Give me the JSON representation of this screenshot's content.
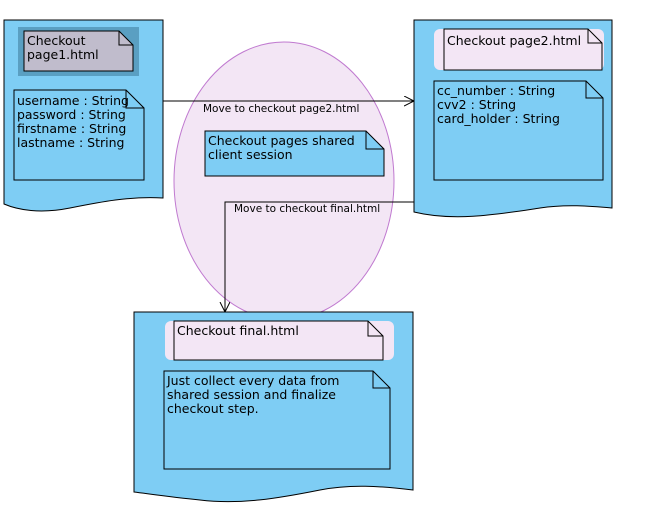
{
  "doc1": {
    "title_lines": [
      "Checkout",
      "page1.html"
    ],
    "fields": [
      "username : String",
      "password : String",
      "firstname : String",
      "lastname : String"
    ]
  },
  "doc2": {
    "title": "Checkout page2.html",
    "fields": [
      "cc_number : String",
      "cvv2 : String",
      "card_holder : String"
    ]
  },
  "session_note": [
    "Checkout pages shared",
    "client session"
  ],
  "edges": {
    "to_page2": "Move to checkout page2.html",
    "to_final": "Move to checkout final.html"
  },
  "doc3": {
    "title": "Checkout final.html",
    "body_lines": [
      "Just collect every data from",
      "shared session and finalize",
      "checkout step."
    ]
  },
  "colors": {
    "document_fill": "#7ecdf4",
    "note_fill": "#f3e6f5",
    "ellipse_stroke": "#c07ad0",
    "dark_note_fill": "#c0bccc",
    "dark_note_frame": "#5a9fc2"
  }
}
